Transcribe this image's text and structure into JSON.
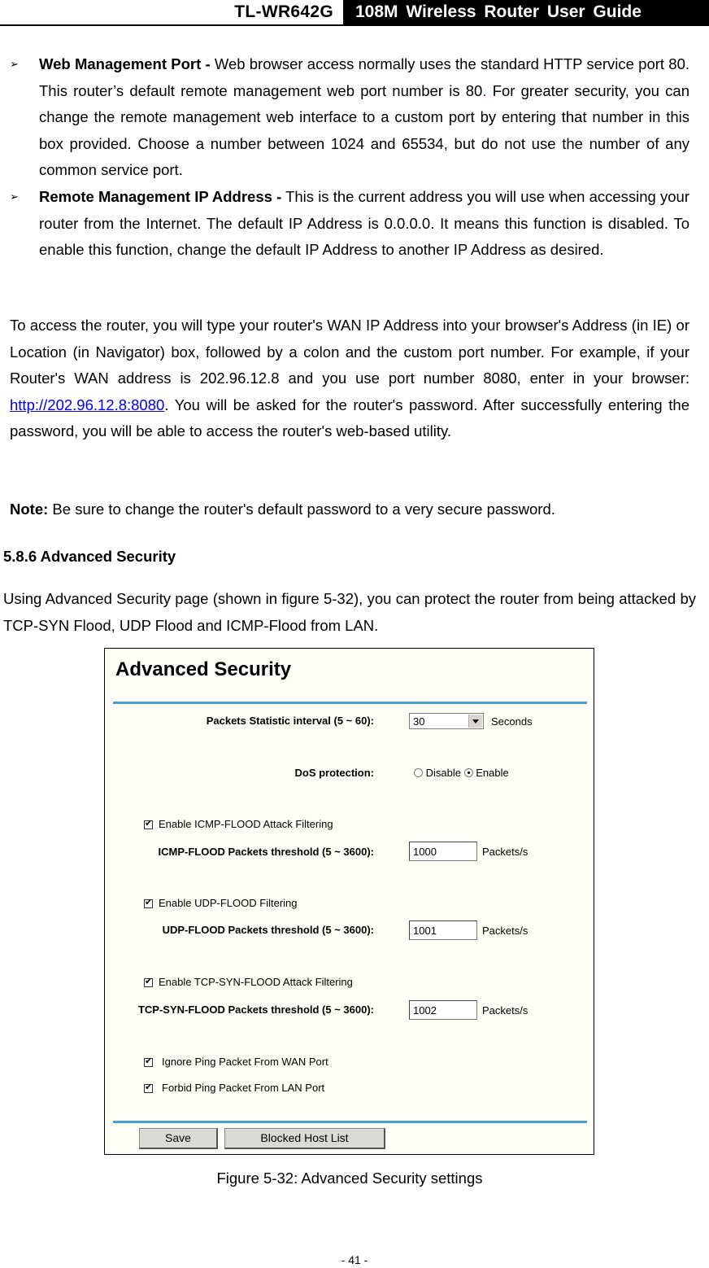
{
  "header": {
    "model": "TL-WR642G",
    "guide_title": "108M Wireless Router User Guide"
  },
  "bullets": [
    {
      "term": "Web Management Port -",
      "text": " Web browser access normally uses the standard HTTP service port 80. This router’s default remote management web port number is 80",
      "text_end": "For greater security, you can change the remote management web interface to a custom port by entering that number in this box provided. Choose a number between 1024 and 65534, but do not use the number of any common service port."
    },
    {
      "term": "Remote Management IP Address -",
      "text": " This is the current address you will use when accessing your router from the Internet. The default IP Address is 0.0.0.0. It means this function is disabled. To enable this function, change the default IP Address to another IP Address as desired."
    }
  ],
  "access_paragraph": {
    "before_link": "To access the router, you will type your router's WAN IP Address into your browser's Address (in IE) or Location (in Navigator) box, followed by a colon and the custom port number. For example, if your Router's WAN address is 202.96.12.8 and you use port number 8080, enter in your browser: ",
    "link": "http://202.96.12.8:8080",
    "after_link": ". You will be asked for the router's password. After successfully entering the password, you will be able to access the router's web-based utility."
  },
  "note": {
    "label": "Note:",
    "text": " Be sure to change the router's default password to a very secure password."
  },
  "section": {
    "heading": "5.8.6 Advanced Security",
    "intro": "Using Advanced Security page (shown in figure 5-32), you can protect the router from being attacked by TCP-SYN Flood, UDP Flood and ICMP-Flood from LAN."
  },
  "figure": {
    "title": "Advanced Security",
    "packets_interval": {
      "label": "Packets Statistic interval (5 ~ 60):",
      "value": "30",
      "unit": "Seconds"
    },
    "dos": {
      "label": "DoS protection:",
      "options": [
        "Disable",
        "Enable"
      ],
      "selected": "Enable"
    },
    "icmp": {
      "checkbox": "Enable ICMP-FLOOD Attack Filtering",
      "checked": true,
      "label": "ICMP-FLOOD Packets threshold (5 ~ 3600):",
      "value": "1000",
      "unit": "Packets/s"
    },
    "udp": {
      "checkbox": "Enable UDP-FLOOD Filtering",
      "checked": true,
      "label": "UDP-FLOOD Packets threshold (5 ~ 3600):",
      "value": "1001",
      "unit": "Packets/s"
    },
    "tcp": {
      "checkbox": "Enable TCP-SYN-FLOOD Attack Filtering",
      "checked": true,
      "label": "TCP-SYN-FLOOD Packets threshold (5 ~ 3600):",
      "value": "1002",
      "unit": "Packets/s"
    },
    "ignore_wan_ping": {
      "label": "Ignore Ping Packet From WAN Port",
      "checked": true
    },
    "forbid_lan_ping": {
      "label": "Forbid Ping Packet From LAN Port",
      "checked": true
    },
    "buttons": {
      "save": "Save",
      "blocked_hosts": "Blocked Host List"
    },
    "accent_color": "#4aa1c9",
    "background_color": "#fefef6"
  },
  "caption": "Figure 5-32: Advanced Security settings",
  "page_number": "- 41 -"
}
